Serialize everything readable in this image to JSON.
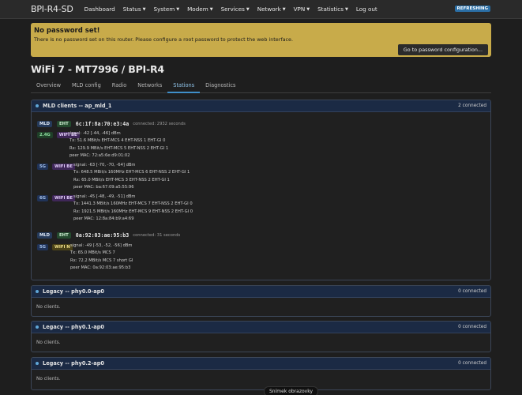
{
  "header": {
    "brand": "BPI-R4-SD",
    "menu": [
      "Dashboard",
      "Status",
      "System",
      "Modem",
      "Services",
      "Network",
      "VPN",
      "Statistics",
      "Log out"
    ],
    "refresh_badge": "REFRESHING"
  },
  "alert": {
    "title": "No password set!",
    "text": "There is no password set on this router. Please configure a root password to protect the web interface.",
    "button": "Go to password configuration..."
  },
  "page_title": "WiFi 7 - MT7996 / BPI-R4",
  "tabs": [
    "Overview",
    "MLD config",
    "Radio",
    "Networks",
    "Stations",
    "Diagnostics"
  ],
  "mld_panel": {
    "title": "MLD clients -- ap_mld_1",
    "count": "2 connected",
    "clients": [
      {
        "badge_mld": "MLD",
        "badge_eht": "EHT",
        "mac": "6c:1f:8a:70:e3:4a",
        "connected": "connected: 2932 seconds",
        "links": [
          {
            "band": "2.4G",
            "mode": "WIFI BE",
            "signal": "signal: -42 [-44, -46] dBm",
            "tx": "Tx: 51.6 MBit/s EHT-MCS 4 EHT-NSS 1 EHT-GI 0",
            "rx": "Rx: 129.9 MBit/s EHT-MCS 5 EHT-NSS 2 EHT-GI 1",
            "peer": "peer MAC: 72:a5:6e:d9:01:02"
          },
          {
            "band": "5G",
            "mode": "WIFI BE",
            "signal": "signal: -63 [-70, -70, -64] dBm",
            "tx": "Tx: 648.5 MBit/s 160MHz EHT-MCS 6 EHT-NSS 2 EHT-GI 1",
            "rx": "Rx: 65.0 MBit/s EHT-MCS 3 EHT-NSS 2 EHT-GI 1",
            "peer": "peer MAC: ba:67:09:a5:55:96"
          },
          {
            "band": "6G",
            "mode": "WIFI BE",
            "signal": "signal: -45 [-48, -49, -51] dBm",
            "tx": "Tx: 1441.3 MBit/s 160MHz EHT-MCS 7 EHT-NSS 2 EHT-GI 0",
            "rx": "Rx: 1921.5 MBit/s 160MHz EHT-MCS 9 EHT-NSS 2 EHT-GI 0",
            "peer": "peer MAC: 12:8a:84:b9:a4:69"
          }
        ]
      },
      {
        "badge_mld": "MLD",
        "badge_eht": "EHT",
        "mac": "0a:92:03:ae:95:b3",
        "connected": "connected: 31 seconds",
        "links": [
          {
            "band": "5G",
            "mode": "WIFI N",
            "signal": "signal: -49 [-53, -52, -56] dBm",
            "tx": "Tx: 65.0 MBit/s MCS 7",
            "rx": "Rx: 72.2 MBit/s MCS 7 short GI",
            "peer": "peer MAC: 0a:92:03:ae:95:b3"
          }
        ]
      }
    ]
  },
  "legacy_panels": [
    {
      "title": "Legacy -- phy0.0-ap0",
      "count": "0 connected",
      "empty": "No clients."
    },
    {
      "title": "Legacy -- phy0.1-ap0",
      "count": "0 connected",
      "empty": "No clients."
    },
    {
      "title": "Legacy -- phy0.2-ap0",
      "count": "0 connected",
      "empty": "No clients."
    }
  ],
  "tooltip": "Snímek obrazovky"
}
